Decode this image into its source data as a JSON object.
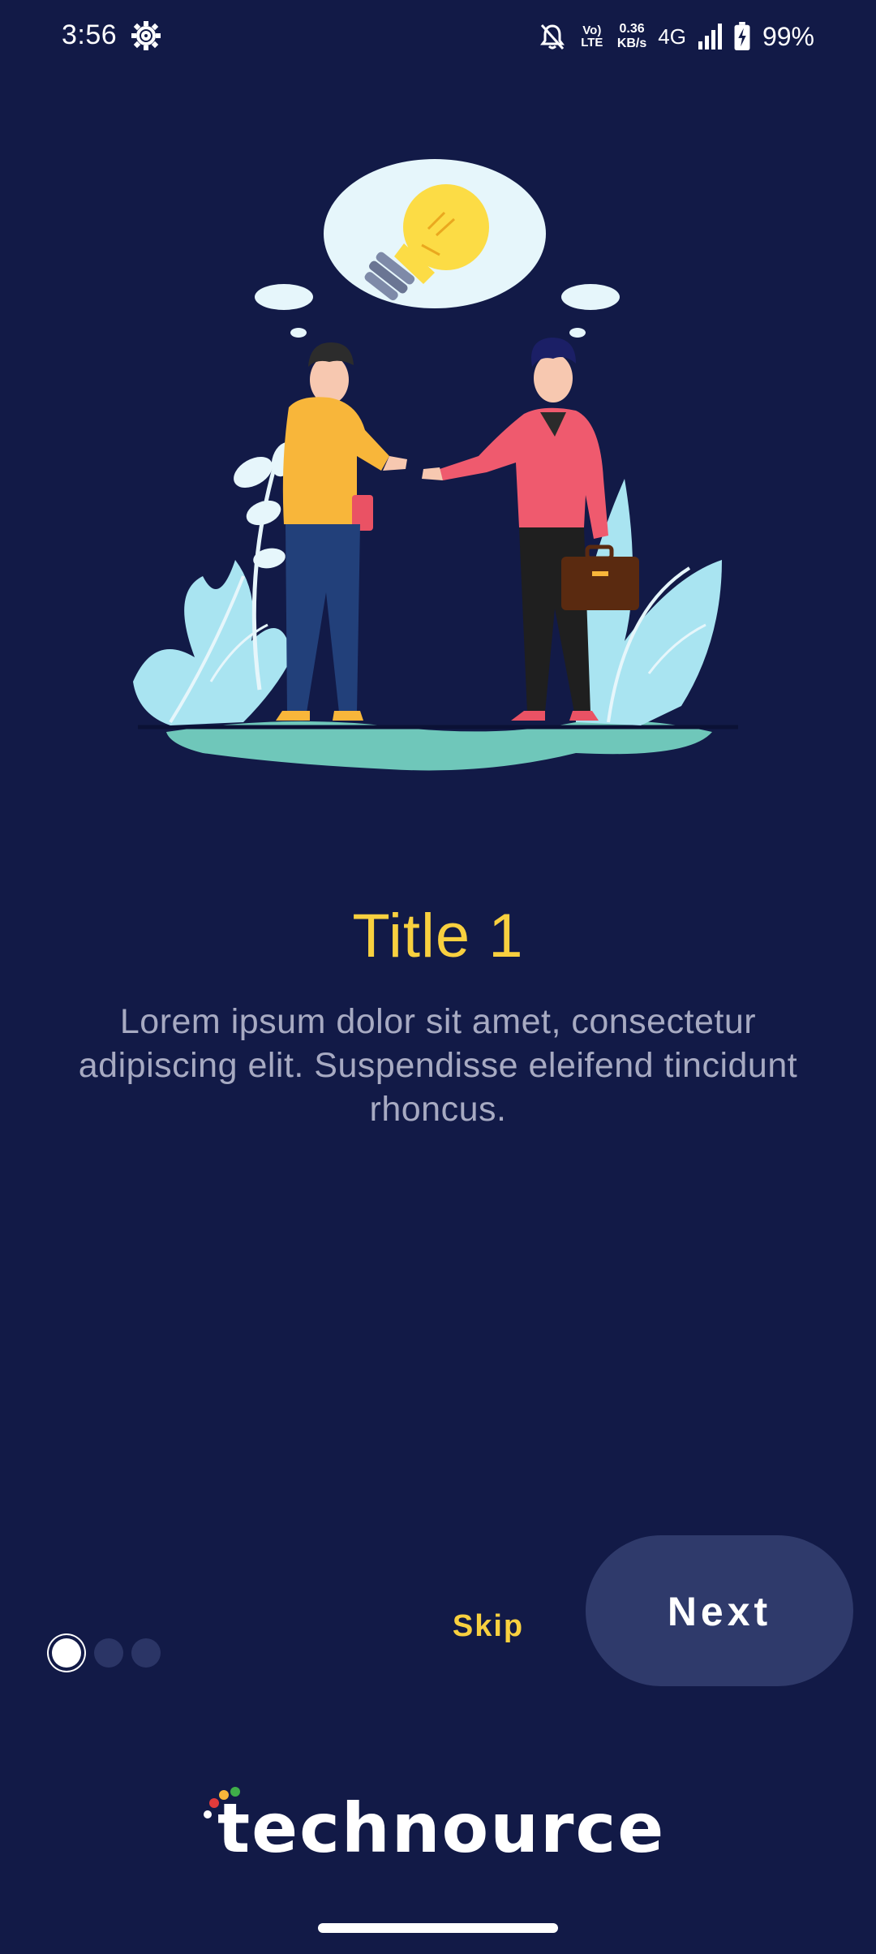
{
  "status_bar": {
    "time": "3:56",
    "settings_icon": "gear-icon",
    "volte": "Vo) LTE",
    "speed_value": "0.36",
    "speed_unit": "KB/s",
    "network": "4G",
    "battery": "99%"
  },
  "slide": {
    "illustration": "two-people-handshake-idea-illustration",
    "title": "Title 1",
    "description": "Lorem ipsum dolor sit amet, consectetur adipiscing elit. Suspendisse eleifend tincidunt rhoncus."
  },
  "pager": {
    "total": 3,
    "current": 1
  },
  "actions": {
    "skip_label": "Skip",
    "next_label": "Next"
  },
  "brand": {
    "logo_text": "technource"
  },
  "colors": {
    "background": "#121a47",
    "accent": "#f8d03f",
    "button_bg": "#2f3a6b",
    "description_text": "#a7aac2"
  }
}
